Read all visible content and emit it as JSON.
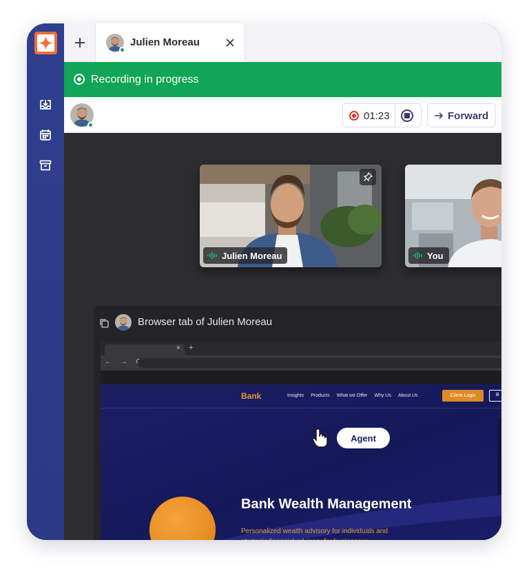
{
  "app": {
    "colors": {
      "sidebar": "#2f3f8f",
      "brand": "#f26b3a",
      "recording": "#11a557",
      "record_dot": "#e0392f",
      "accent": "#3a3a6e"
    }
  },
  "sidebar": {
    "icons": [
      "inbox-download-icon",
      "calendar-icon",
      "archive-icon"
    ]
  },
  "tabs": {
    "new_tab_icon": "plus-icon",
    "active_tab": {
      "name": "Julien Moreau",
      "close_icon": "close-icon"
    }
  },
  "recording": {
    "text": "Recording in progress"
  },
  "toolbar": {
    "timer": "01:23",
    "forward_label": "Forward"
  },
  "participants": [
    {
      "name": "Julien Moreau",
      "pinned": true
    },
    {
      "name": "You"
    }
  ],
  "screen_share": {
    "title": "Browser tab of Julien Moreau",
    "browser": {
      "tab_close": "×",
      "new_tab": "+",
      "nav": "← → C"
    },
    "website": {
      "brand": "Bank",
      "menu": [
        "Insights",
        "Products",
        "What we Offer",
        "Why Us",
        "About Us"
      ],
      "login_label": "Client Login",
      "second_button": "B",
      "agent_label": "Agent",
      "heading": "Bank Wealth Management",
      "subtitle": "Personalized wealth advisory for individuals and strategic financial advisory for businesses"
    }
  }
}
